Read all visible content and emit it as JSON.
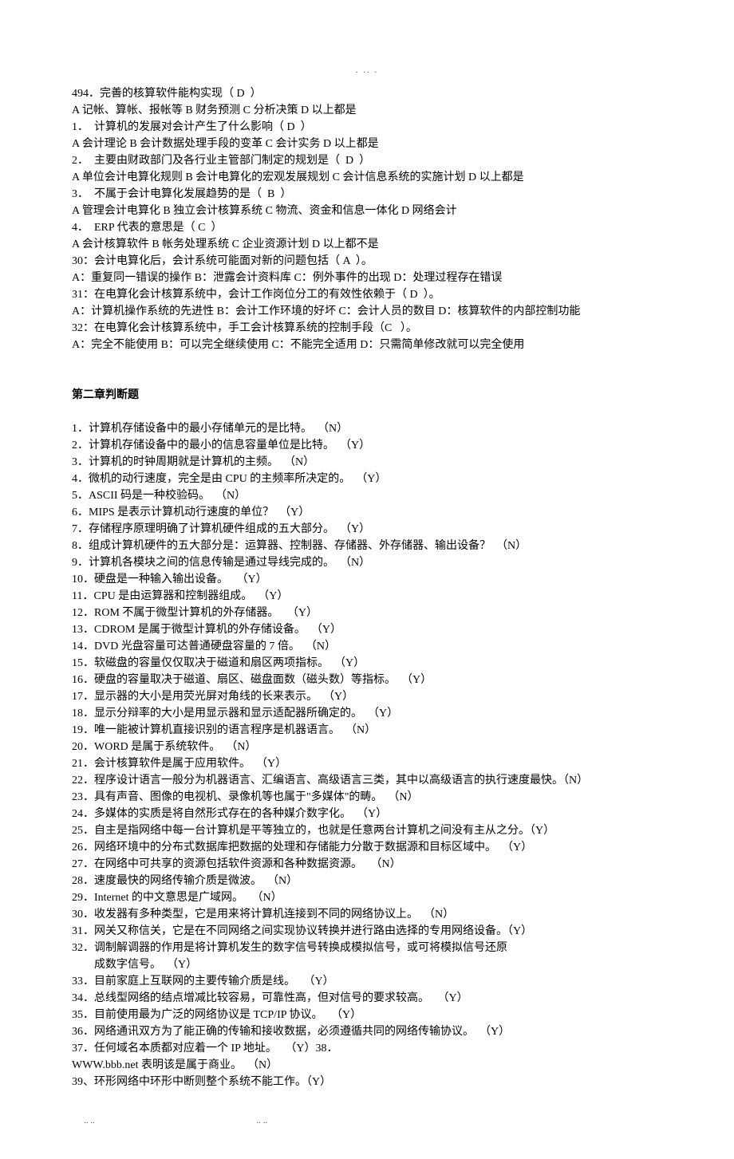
{
  "topdots": ".                  ..              .",
  "q494": "494．完善的核算软件能构实现（ D  ）",
  "q494opt": "A 记帐、算帐、报帐等 B 财务预测 C 分析决策 D 以上都是",
  "q1": "1．  计算机的发展对会计产生了什么影响（ D  ）",
  "q1opt": "A 会计理论 B 会计数据处理手段的变革 C 会计实务 D 以上都是",
  "q2": "2．  主要由财政部门及各行业主管部门制定的规划是（  D  ）",
  "q2opt": "A 单位会计电算化规则 B 会计电算化的宏观发展规划 C 会计信息系统的实施计划 D 以上都是",
  "q3": "3．  不属于会计电算化发展趋势的是（  B  ）",
  "q3opt": "A 管理会计电算化 B 独立会计核算系统 C 物流、资金和信息一体化 D 网络会计",
  "q4": "4．  ERP 代表的意思是（ C  ）",
  "q4opt": "A 会计核算软件 B 帐务处理系统 C 企业资源计划 D 以上都不是",
  "q30": "30：会计电算化后，会计系统可能面对新的问题包括（ A  ）。",
  "q30opt": "A：重复同一错误的操作 B：泄露会计资料库 C：例外事件的出现 D：处理过程存在错误",
  "q31": "31：在电算化会计核算系统中，会计工作岗位分工的有效性依赖于（ D  ）。",
  "q31opt": "A：计算机操作系统的先进性 B：会计工作环境的好坏 C：会计人员的数目 D：核算软件的内部控制功能",
  "q32": "32：在电算化会计核算系统中，手工会计核算系统的控制手段（C   ）。",
  "q32opt": "A：完全不能使用 B：可以完全继续使用 C：不能完全适用 D：只需简单修改就可以完全使用",
  "section2": "第二章判断题",
  "j1": "1．计算机存储设备中的最小存储单元的是比特。  （N）",
  "j2": "2．计算机存储设备中的最小的信息容量单位是比特。  （Y）",
  "j3": "3．计算机的时钟周期就是计算机的主频。  （N）",
  "j4": "4．微机的动行速度，完全是由 CPU 的主频率所决定的。  （Y）",
  "j5": "5．ASCII 码是一种校验码。  （N）",
  "j6": "6．MIPS 是表示计算机动行速度的单位？  （Y）",
  "j7": "7．存储程序原理明确了计算机硬件组成的五大部分。  （Y）",
  "j8": "8．组成计算机硬件的五大部分是：运算器、控制器、存储器、外存储器、输出设备？  （N）",
  "j9": "9．计算机各模块之间的信息传输是通过导线完成的。  （N）",
  "j10": "10．硬盘是一种输入输出设备。   （Y）",
  "j11": "11．CPU 是由运算器和控制器组成。  （Y）",
  "j12": "12．ROM 不属于微型计算机的外存储器。   （Y）",
  "j13": "13．CDROM 是属于微型计算机的外存储设备。  （Y）",
  "j14": "14．DVD 光盘容量可达普通硬盘容量的 7 倍。  （N）",
  "j15": "15．软磁盘的容量仅仅取决于磁道和扇区两项指标。  （Y）",
  "j16": "16．硬盘的容量取决于磁道、扇区、磁盘面数（磁头数）等指标。  （Y）",
  "j17": "17．显示器的大小是用荧光屏对角线的长来表示。  （Y）",
  "j18": "18．显示分辩率的大小是用显示器和显示适配器所确定的。  （Y）",
  "j19": "19．唯一能被计算机直接识别的语言程序是机器语言。  （N）",
  "j20": "20．WORD 是属于系统软件。  （N）",
  "j21": "21．会计核算软件是属于应用软件。  （Y）",
  "j22": "22．程序设计语言一般分为机器语言、汇编语言、高级语言三类，其中以高级语言的执行速度最快。（N）",
  "j23": "23．具有声音、图像的电视机、录像机等也属于\"多媒体\"的畴。  （N）",
  "j24": "24．多媒体的实质是将自然形式存在的各种媒介数字化。  （Y）",
  "j25": "25．自主是指网络中每一台计算机是平等独立的，也就是任意两台计算机之间没有主从之分。（Y）",
  "j26": "26．网络环境中的分布式数据库把数据的处理和存储能力分散于数据源和目标区域中。  （Y）",
  "j27": "27．在网络中可共享的资源包括软件资源和各种数据资源。   （N）",
  "j28": "28．速度最快的网络传输介质是微波。  （N）",
  "j29": "29．Internet 的中文意思是广域网。   （N）",
  "j30": "30．收发器有多种类型，它是用来将计算机连接到不同的网络协议上。  （N）",
  "j31": "31．网关又称信关，它是在不同网络之间实现协议转换并进行路由选择的专用网络设备。（Y）",
  "j32a": "32．调制解调器的作用是将计算机发生的数字信号转换成模拟信号，或可将模拟信号还原",
  "j32b": "成数字信号。  （Y）",
  "j33": "33．目前家庭上互联网的主要传输介质是线。   （Y）",
  "j34": "34．总线型网络的结点增减比较容易，可靠性高，但对信号的要求较高。   （Y）",
  "j35": "35．目前使用最为广泛的网络协议是 TCP/IP 协议。   （Y）",
  "j36": "36．网络通讯双方为了能正确的传输和接收数据，必须遵循共同的网络传输协议。  （Y）",
  "j37": "37．任何域名本质都对应着一个 IP 地址。   （Y）38．",
  "j38": "WWW.bbb.net 表明该是属于商业。  （N）",
  "j39": "39、环形网络中环形中断则整个系统不能工作。（Y）",
  "bottomdots1": "..         ..",
  "bottomdots2": "..         .."
}
